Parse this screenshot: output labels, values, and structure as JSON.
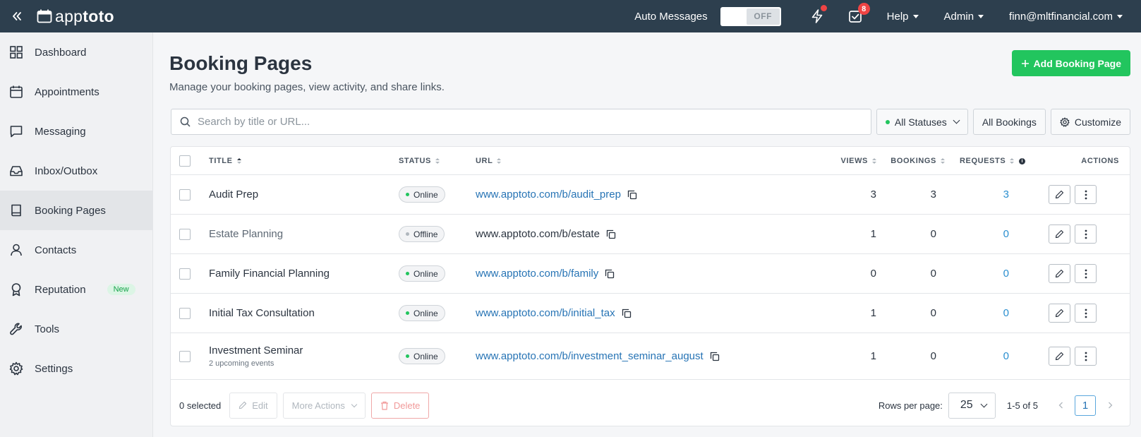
{
  "topbar": {
    "logo": {
      "light": "app",
      "bold": "toto"
    },
    "auto_messages_label": "Auto Messages",
    "toggle_state": "OFF",
    "tasks_count": "8",
    "help_label": "Help",
    "admin_label": "Admin",
    "user_email": "finn@mltfinancial.com"
  },
  "sidebar": {
    "items": [
      {
        "label": "Dashboard",
        "icon": "grid-icon"
      },
      {
        "label": "Appointments",
        "icon": "calendar-icon"
      },
      {
        "label": "Messaging",
        "icon": "chat-icon"
      },
      {
        "label": "Inbox/Outbox",
        "icon": "inbox-icon"
      },
      {
        "label": "Booking Pages",
        "icon": "book-icon",
        "active": true
      },
      {
        "label": "Contacts",
        "icon": "user-icon"
      },
      {
        "label": "Reputation",
        "icon": "ribbon-icon",
        "badge": "New"
      },
      {
        "label": "Tools",
        "icon": "wrench-icon"
      },
      {
        "label": "Settings",
        "icon": "gear-icon"
      }
    ]
  },
  "main": {
    "title": "Booking Pages",
    "subtitle": "Manage your booking pages, view activity, and share links.",
    "add_button": "Add Booking Page",
    "search_placeholder": "Search by title or URL...",
    "status_filter": "All Statuses",
    "bookings_filter": "All Bookings",
    "customize": "Customize"
  },
  "table": {
    "headers": {
      "title": "TITLE",
      "status": "STATUS",
      "url": "URL",
      "views": "VIEWS",
      "bookings": "BOOKINGS",
      "requests": "REQUESTS",
      "actions": "ACTIONS"
    },
    "rows": [
      {
        "title": "Audit Prep",
        "subtitle": "",
        "status": "Online",
        "url": "www.apptoto.com/b/audit_prep",
        "views": "3",
        "bookings": "3",
        "requests": "3"
      },
      {
        "title": "Estate Planning",
        "subtitle": "",
        "status": "Offline",
        "url": "www.apptoto.com/b/estate",
        "views": "1",
        "bookings": "0",
        "requests": "0"
      },
      {
        "title": "Family Financial Planning",
        "subtitle": "",
        "status": "Online",
        "url": "www.apptoto.com/b/family",
        "views": "0",
        "bookings": "0",
        "requests": "0"
      },
      {
        "title": "Initial Tax Consultation",
        "subtitle": "",
        "status": "Online",
        "url": "www.apptoto.com/b/initial_tax",
        "views": "1",
        "bookings": "0",
        "requests": "0"
      },
      {
        "title": "Investment Seminar",
        "subtitle": "2 upcoming events",
        "status": "Online",
        "url": "www.apptoto.com/b/investment_seminar_august",
        "views": "1",
        "bookings": "0",
        "requests": "0"
      }
    ]
  },
  "footer": {
    "selected": "0 selected",
    "edit": "Edit",
    "more_actions": "More Actions",
    "delete": "Delete",
    "rows_per_page_label": "Rows per page:",
    "rows_per_page": "25",
    "range": "1-5 of 5",
    "page": "1"
  },
  "colors": {
    "topbar": "#2d3f4e",
    "accent_green": "#22c55e",
    "link_blue": "#2774b5",
    "badge_red": "#ef4444"
  }
}
